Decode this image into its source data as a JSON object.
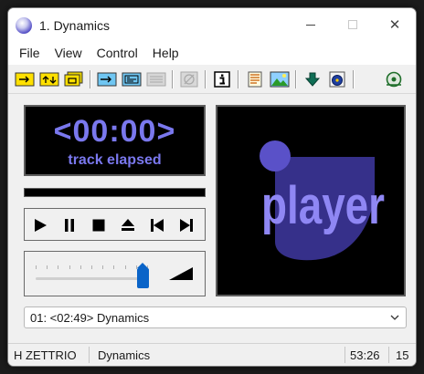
{
  "window": {
    "title": "1. Dynamics",
    "minimize_glyph": "",
    "maximize_glyph": "",
    "close_glyph": "✕"
  },
  "menu": [
    "File",
    "View",
    "Control",
    "Help"
  ],
  "toolbar": {
    "buttons": [
      {
        "name": "open-file-icon"
      },
      {
        "name": "open-folder-icon"
      },
      {
        "name": "open-playlist-icon"
      },
      {
        "name": "mini-mode-icon"
      },
      {
        "name": "normal-mode-icon"
      },
      {
        "name": "full-mode-icon",
        "disabled": true
      },
      {
        "name": "visualization-icon",
        "disabled": true
      },
      {
        "name": "info-icon"
      },
      {
        "name": "playlist-icon"
      },
      {
        "name": "picture-icon"
      },
      {
        "name": "download-icon"
      },
      {
        "name": "cd-player-icon"
      },
      {
        "name": "settings-disc-icon"
      }
    ]
  },
  "display": {
    "time": "<00:00>",
    "label": "track elapsed",
    "accent_color": "#7a78ee"
  },
  "progress": {
    "fraction": 0
  },
  "transport": [
    "play-icon",
    "pause-icon",
    "stop-icon",
    "eject-icon",
    "previous-track-icon",
    "next-track-icon"
  ],
  "volume": {
    "level": 0.96
  },
  "artwork": {
    "logo_text": "player"
  },
  "track_select": {
    "value": "01: <02:49> Dynamics"
  },
  "status": {
    "artist": "H ZETTRIO",
    "title": "Dynamics",
    "duration": "53:26",
    "count": "15"
  }
}
